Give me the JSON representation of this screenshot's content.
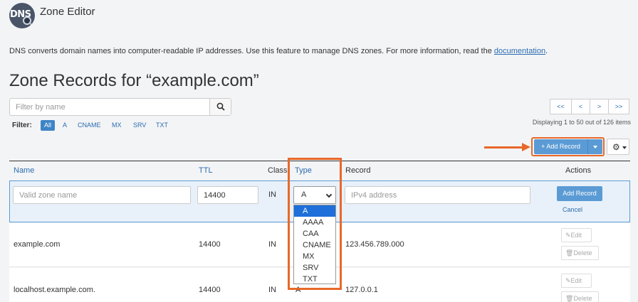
{
  "header": {
    "logo_text": "DNS",
    "app_title": "Zone Editor",
    "description_prefix": "DNS converts domain names into computer-readable IP addresses. Use this feature to manage DNS zones. For more information, read the ",
    "description_link": "documentation",
    "description_suffix": "."
  },
  "zone_title": "Zone Records for “example.com”",
  "search": {
    "placeholder": "Filter by name"
  },
  "filter": {
    "label": "Filter:",
    "options": [
      "All",
      "A",
      "CNAME",
      "MX",
      "SRV",
      "TXT"
    ],
    "active": "All"
  },
  "pagination": {
    "buttons": [
      "<<",
      "<",
      ">",
      ">>"
    ],
    "info": "Displaying 1 to 50 out of 126 items"
  },
  "toolbar": {
    "add_record_label": "+ Add Record"
  },
  "table": {
    "headers": {
      "name": "Name",
      "ttl": "TTL",
      "class": "Class",
      "type": "Type",
      "record": "Record",
      "actions": "Actions"
    },
    "new_row": {
      "name_placeholder": "Valid zone name",
      "ttl_value": "14400",
      "class_value": "IN",
      "type_value": "A",
      "record_placeholder": "IPv4 address",
      "add_label": "Add Record",
      "cancel_label": "Cancel"
    },
    "rows": [
      {
        "name": "example.com",
        "ttl": "14400",
        "class": "IN",
        "type": "A",
        "record": "123.456.789.000",
        "edit": "Edit",
        "delete": "Delete"
      },
      {
        "name": "localhost.example.com.",
        "ttl": "14400",
        "class": "IN",
        "type": "A",
        "record": "127.0.0.1",
        "edit": "Edit",
        "delete": "Delete"
      }
    ]
  },
  "type_dropdown": {
    "options": [
      "A",
      "AAAA",
      "CAA",
      "CNAME",
      "MX",
      "SRV",
      "TXT"
    ],
    "selected": "A"
  },
  "colors": {
    "accent": "#5b9bd5",
    "highlight": "#e8682a",
    "link": "#2b6cb0",
    "selected_option": "#1e6fd9"
  },
  "icons": [
    "dns-logo-icon",
    "search-icon",
    "plus-icon",
    "caret-down-icon",
    "gear-icon",
    "chevron-down-icon",
    "pencil-icon",
    "trash-icon",
    "arrow-right-icon"
  ]
}
